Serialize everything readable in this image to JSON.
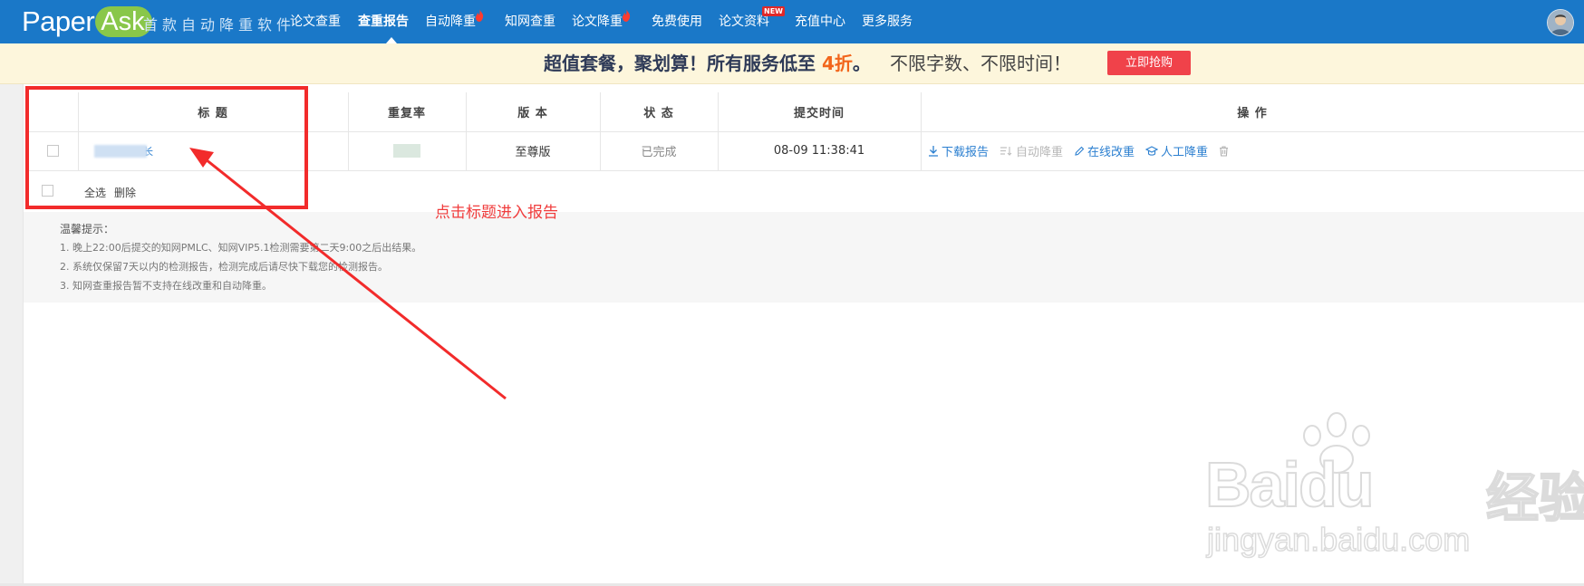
{
  "brand": {
    "logo_paper": "Paper",
    "logo_ask": "Ask",
    "slogan": "首款自动降重软件"
  },
  "nav": {
    "items": [
      {
        "label": "论文查重"
      },
      {
        "label": "查重报告",
        "active": true
      },
      {
        "label": "自动降重",
        "icon": "fire-icon"
      },
      {
        "label": "知网查重"
      },
      {
        "label": "论文降重",
        "icon": "fire-icon"
      },
      {
        "label": "免费使用"
      },
      {
        "label": "论文资料",
        "badge": "NEW"
      },
      {
        "label": "充值中心"
      },
      {
        "label": "更多服务"
      }
    ]
  },
  "promo": {
    "lead": "超值套餐，聚划算！所有服务低至 ",
    "discount": "4折",
    "after": "。",
    "sub": "不限字数、不限时间！",
    "button": "立即抢购"
  },
  "table": {
    "headers": {
      "title": "标 题",
      "rate": "重复率",
      "version": "版 本",
      "status": "状 态",
      "time": "提交时间",
      "ops": "操 作"
    },
    "rows": [
      {
        "title_tail": "长",
        "version": "至尊版",
        "status": "已完成",
        "time": "08-09 11:38:41"
      }
    ],
    "operations": {
      "download": "下载报告",
      "auto_reduce": "自动降重",
      "online_edit": "在线改重",
      "manual_reduce": "人工降重"
    },
    "footer": {
      "select_all": "全选",
      "delete": "删除"
    }
  },
  "annotation": {
    "text": "点击标题进入报告"
  },
  "tips": {
    "title": "温馨提示：",
    "lines": [
      "1. 晚上22:00后提交的知网PMLC、知网VIP5.1检测需要第二天9:00之后出结果。",
      "2. 系统仅保留7天以内的检测报告，检测完成后请尽快下载您的检测报告。",
      "3. 知网查重报告暂不支持在线改重和自动降重。"
    ]
  },
  "watermark": {
    "bai": "Bai",
    "du": "du",
    "jingyan": "经验",
    "url": "jingyan.baidu.com"
  },
  "colors": {
    "nav_bg": "#1a78c8",
    "promo_bg": "#fdf6dc",
    "promo_accent": "#f2651b",
    "promo_button": "#f0424a",
    "link": "#2b7fd0",
    "annotation_red": "#f22b2b"
  }
}
